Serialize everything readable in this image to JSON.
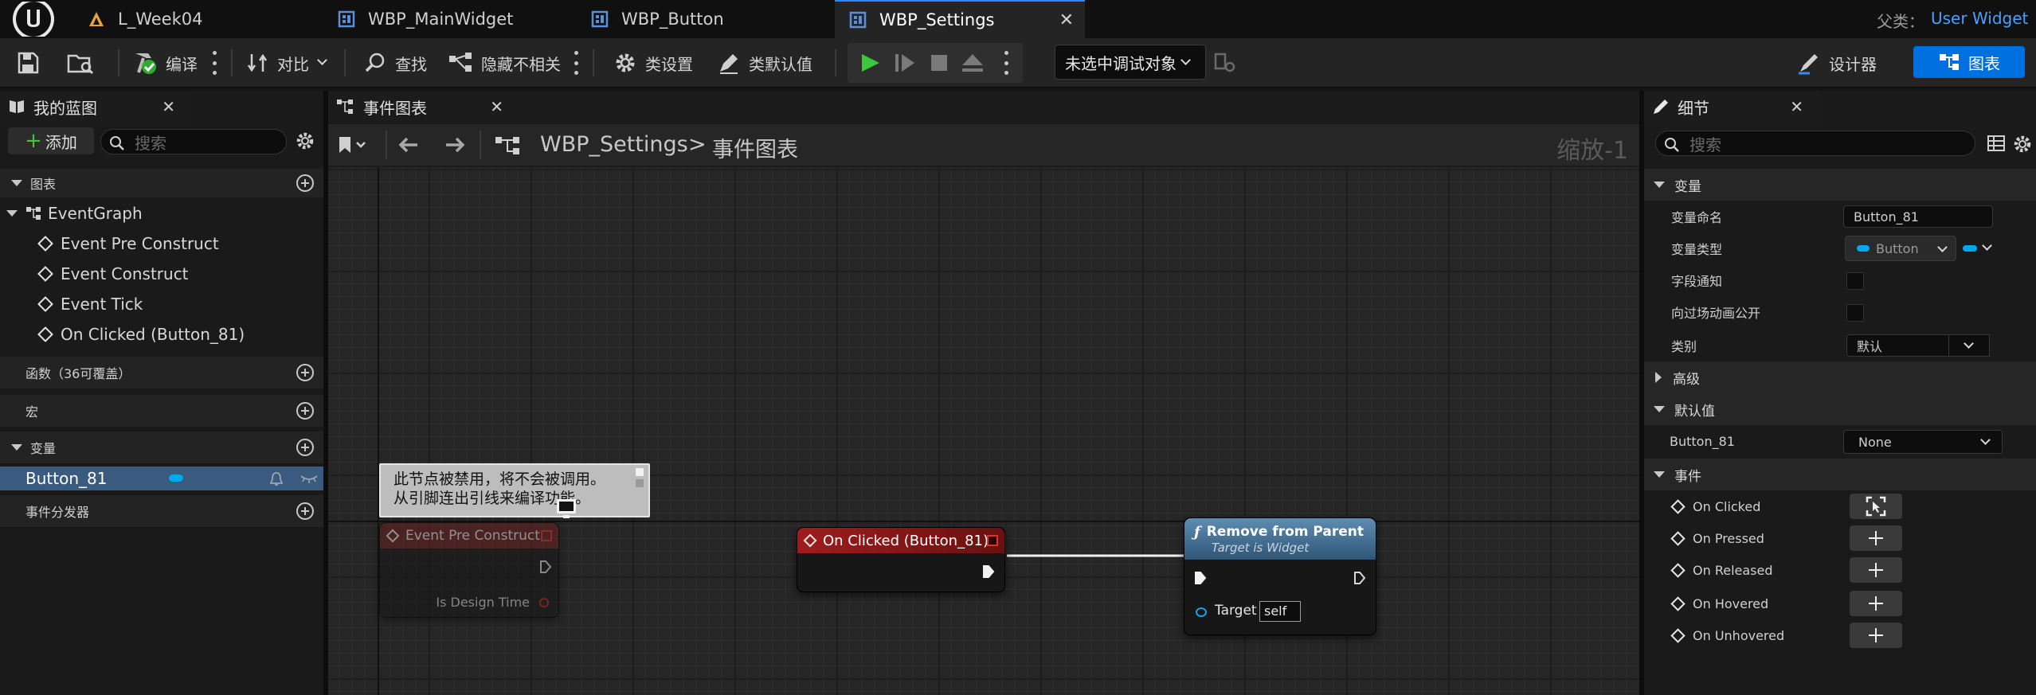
{
  "tabs": [
    {
      "label": "L_Week04",
      "icon": "level-icon",
      "active": false
    },
    {
      "label": "WBP_MainWidget",
      "icon": "widget-blueprint-icon",
      "active": false
    },
    {
      "label": "WBP_Button",
      "icon": "widget-blueprint-icon",
      "active": false
    },
    {
      "label": "WBP_Settings",
      "icon": "widget-blueprint-icon",
      "active": true
    }
  ],
  "parent_class": {
    "label": "父类：",
    "value": "User Widget"
  },
  "toolbar": {
    "compile": "编译",
    "diff": "对比",
    "find": "查找",
    "hide_unrelated": "隐藏不相关",
    "class_settings": "类设置",
    "class_defaults": "类默认值",
    "debug_object": "未选中调试对象",
    "designer": "设计器",
    "graph": "图表"
  },
  "left_panel": {
    "tab_label": "我的蓝图",
    "add_label": "添加",
    "search_placeholder": "搜索",
    "sections": {
      "graphs": "图表",
      "functions": "函数（36可覆盖）",
      "macros": "宏",
      "variables": "变量",
      "dispatchers": "事件分发器"
    },
    "event_graph": "EventGraph",
    "events": [
      "Event Pre Construct",
      "Event Construct",
      "Event Tick",
      "On Clicked (Button_81)"
    ],
    "variables": [
      "Button_81"
    ]
  },
  "graph": {
    "tab_label": "事件图表",
    "breadcrumb_root": "WBP_Settings",
    "breadcrumb_sep": ">",
    "breadcrumb_leaf": "事件图表",
    "zoom": "缩放-1",
    "comment_line1": "此节点被禁用，将不会被调用。",
    "comment_line2": "从引脚连出引线来编译功能。",
    "node_pre_construct": {
      "title": "Event Pre Construct",
      "pin": "Is Design Time"
    },
    "node_on_clicked": {
      "title": "On Clicked (Button_81)"
    },
    "node_remove": {
      "title": "Remove from Parent",
      "subtitle": "Target is Widget",
      "pin_label": "Target",
      "pin_value": "self"
    }
  },
  "details": {
    "tab_label": "细节",
    "search_placeholder": "搜索",
    "sec_variable": "变量",
    "var_name_label": "变量命名",
    "var_name_value": "Button_81",
    "var_type_label": "变量类型",
    "var_type_value": "Button",
    "field_notify_label": "字段通知",
    "expose_cinematics_label": "向过场动画公开",
    "category_label": "类别",
    "category_value": "默认",
    "sec_advanced": "高级",
    "sec_default_value": "默认值",
    "default_label": "Button_81",
    "default_value": "None",
    "sec_events": "事件",
    "events": [
      "On Clicked",
      "On Pressed",
      "On Released",
      "On Hovered",
      "On Unhovered"
    ]
  },
  "colors": {
    "accent_blue": "#0070e0",
    "event_red": "#8c1c1c",
    "function_blue": "#4f7fa3",
    "play_green": "#3cc83c",
    "variable_cyan": "#00a8f0"
  }
}
